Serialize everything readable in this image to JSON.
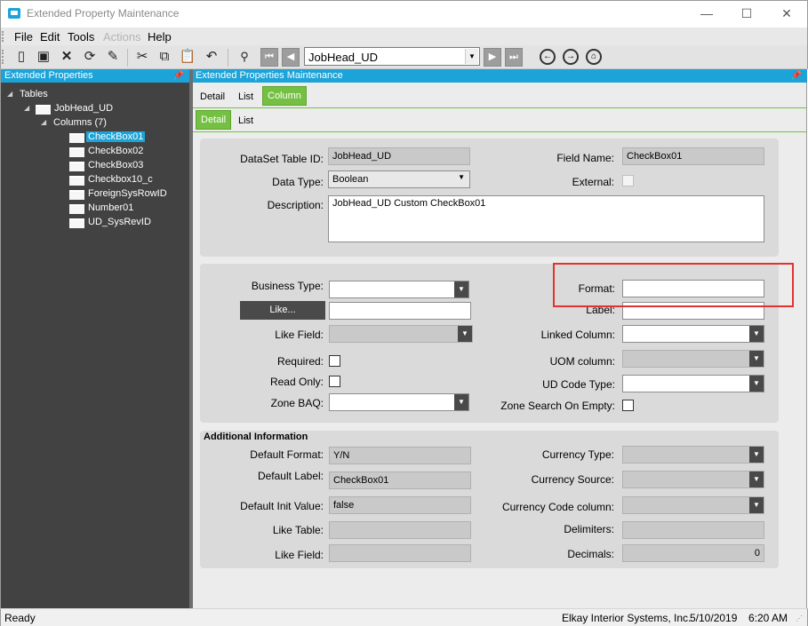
{
  "window": {
    "title": "Extended Property Maintenance",
    "minimize": "—",
    "maximize": "☐",
    "close": "✕"
  },
  "menu": {
    "file": "File",
    "edit": "Edit",
    "tools": "Tools",
    "actions": "Actions",
    "help": "Help"
  },
  "toolbar": {
    "nav_value": "JobHead_UD"
  },
  "left_panel": {
    "title": "Extended Properties",
    "tree": {
      "root": "Tables",
      "table": "JobHead_UD",
      "columns_node": "Columns (7)",
      "columns": [
        "CheckBox01",
        "CheckBox02",
        "CheckBox03",
        "Checkbox10_c",
        "ForeignSysRowID",
        "Number01",
        "UD_SysRevID"
      ],
      "selected": "CheckBox01"
    }
  },
  "main": {
    "title": "Extended Properties Maintenance",
    "tabs": [
      "Detail",
      "List",
      "Column"
    ],
    "active_tab": "Column",
    "subtabs": [
      "Detail",
      "List"
    ],
    "active_subtab": "Detail",
    "general": {
      "dataset_table_id_label": "DataSet Table ID:",
      "dataset_table_id": "JobHead_UD",
      "field_name_label": "Field Name:",
      "field_name": "CheckBox01",
      "data_type_label": "Data Type:",
      "data_type": "Boolean",
      "external_label": "External:",
      "description_label": "Description:",
      "description": "JobHead_UD Custom CheckBox01"
    },
    "properties": {
      "business_type_label": "Business Type:",
      "like_button": "Like...",
      "like_field_label": "Like Field:",
      "required_label": "Required:",
      "read_only_label": "Read Only:",
      "zone_baq_label": "Zone BAQ:",
      "format_label": "Format:",
      "label_label": "Label:",
      "linked_column_label": "Linked Column:",
      "uom_column_label": "UOM column:",
      "ud_code_type_label": "UD Code Type:",
      "zone_search_label": "Zone Search On Empty:"
    },
    "additional": {
      "title": "Additional Information",
      "default_format_label": "Default Format:",
      "default_format": "Y/N",
      "default_label_label": "Default Label:",
      "default_label": "CheckBox01",
      "default_init_label": "Default Init Value:",
      "default_init": "false",
      "like_table_label": "Like Table:",
      "like_field_label": "Like Field:",
      "currency_type_label": "Currency Type:",
      "currency_source_label": "Currency Source:",
      "currency_code_label": "Currency Code column:",
      "delimiters_label": "Delimiters:",
      "decimals_label": "Decimals:",
      "decimals": "0"
    }
  },
  "status": {
    "left": "Ready",
    "company": "Elkay Interior Systems, Inc.",
    "date": "5/10/2019",
    "time": "6:20 AM"
  },
  "colors": {
    "accent": "#1ca3d8",
    "active_tab": "#74c043",
    "highlight": "#e5312e"
  }
}
